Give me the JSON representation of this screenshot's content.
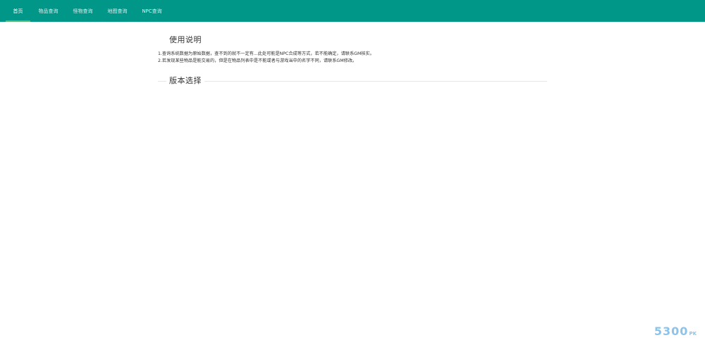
{
  "theme": {
    "accent": "#009688",
    "active_indicator": "#5FB878"
  },
  "nav": {
    "items": [
      {
        "label": "首页",
        "active": true
      },
      {
        "label": "物品查询",
        "active": false
      },
      {
        "label": "怪物查询",
        "active": false
      },
      {
        "label": "地图查询",
        "active": false
      },
      {
        "label": "NPC查询",
        "active": false
      }
    ]
  },
  "usage": {
    "title": "使用说明",
    "lines": [
      "1.查询系统数据为原始数据，查不到的就不一定有...此处可能是NPC合成等方式，若不能确定，请联系GM核实。",
      "2.若发现某些物品是能交易的，但是在物品列表中是不能或者与游戏当中的名字不同，请联系GM修改。"
    ]
  },
  "version": {
    "legend": "版本选择"
  },
  "watermark": {
    "main": "5300",
    "suffix": "PK"
  }
}
